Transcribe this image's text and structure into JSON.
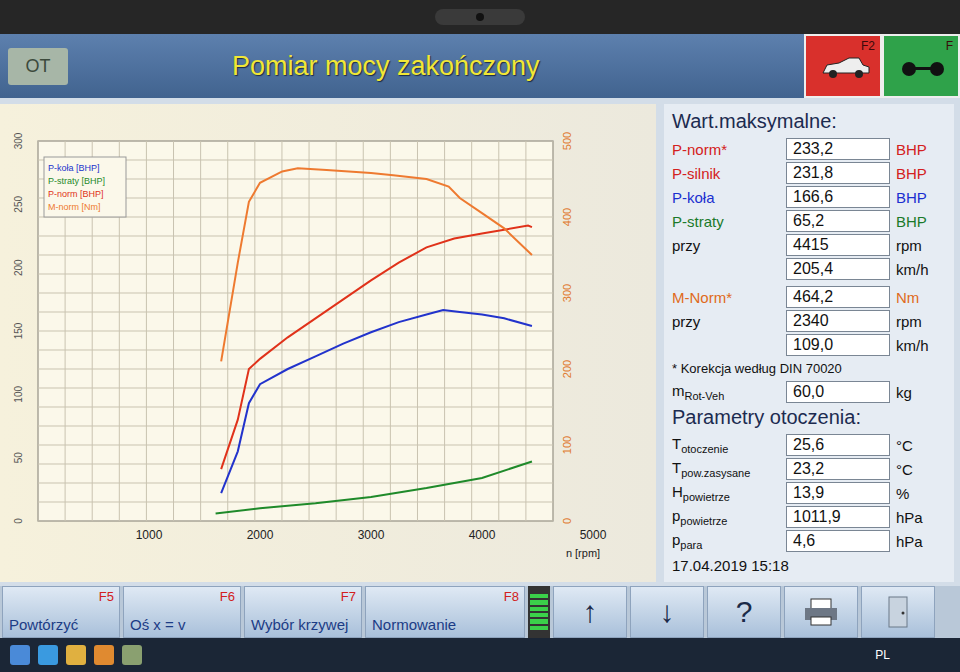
{
  "window": {
    "title": "Pomiar mocy zakończony"
  },
  "header": {
    "left_button": "OT",
    "function_keys": [
      {
        "label": "F2",
        "color": "#d9302c",
        "kind": "car"
      },
      {
        "label": "F",
        "color": "#2fa24a",
        "kind": "trailer"
      }
    ]
  },
  "chart": {
    "x_axis": {
      "ticks": [
        "1000",
        "2000",
        "3000",
        "4000",
        "5000"
      ],
      "label": "n [rpm]"
    },
    "left_axis": {
      "ticks": [
        "0",
        "50",
        "100",
        "150",
        "200",
        "250",
        "300"
      ]
    },
    "right_axis": {
      "ticks": [
        "0",
        "100",
        "200",
        "300",
        "400",
        "500"
      ]
    },
    "series": [
      {
        "name": "P-koła [BHP]",
        "color": "#2233cc",
        "axis": "left",
        "rpm": [
          1650,
          1800,
          1900,
          2000,
          2250,
          2500,
          2750,
          3000,
          3250,
          3500,
          3650,
          3800,
          4000,
          4200,
          4450
        ],
        "values": [
          22,
          55,
          93,
          108,
          120,
          130,
          140,
          149,
          157,
          163,
          166.6,
          165,
          163,
          160,
          154
        ]
      },
      {
        "name": "P-straty [BHP]",
        "color": "#1f8a2a",
        "axis": "left",
        "rpm": [
          1600,
          2000,
          2500,
          3000,
          3500,
          4000,
          4450
        ],
        "values": [
          6,
          10,
          14,
          19,
          26,
          34,
          47
        ]
      },
      {
        "name": "P-norm [BHP]",
        "color": "#e0321a",
        "axis": "left",
        "rpm": [
          1650,
          1800,
          1900,
          2000,
          2250,
          2500,
          2750,
          3000,
          3250,
          3500,
          3750,
          4000,
          4200,
          4415,
          4450
        ],
        "values": [
          41,
          80,
          120,
          128,
          145,
          160,
          175,
          190,
          204,
          216,
          223,
          227,
          230,
          233.2,
          232
        ]
      },
      {
        "name": "M-norm [Nm]",
        "color": "#ee7a30",
        "axis": "right",
        "rpm": [
          1650,
          1800,
          1900,
          2000,
          2200,
          2340,
          2600,
          2800,
          3000,
          3200,
          3500,
          3700,
          3800,
          4000,
          4200,
          4450
        ],
        "values": [
          210,
          340,
          420,
          445,
          460,
          464.2,
          462,
          460,
          458,
          455,
          450,
          440,
          425,
          405,
          385,
          350
        ]
      }
    ]
  },
  "max_values": {
    "title": "Wart.maksymalne:",
    "rows": [
      {
        "label": "P-norm*",
        "value": "233,2",
        "unit": "BHP",
        "color": "#d42020"
      },
      {
        "label": "P-silnik",
        "value": "231,8",
        "unit": "BHP",
        "color": "#d42020"
      },
      {
        "label": "P-koła",
        "value": "166,6",
        "unit": "BHP",
        "color": "#1a2fd0"
      },
      {
        "label": "P-straty",
        "value": "65,2",
        "unit": "BHP",
        "color": "#1a7a2a"
      },
      {
        "label": "przy",
        "value": "4415",
        "unit": "rpm",
        "color": "#111111"
      },
      {
        "label": "",
        "value": "205,4",
        "unit": "km/h",
        "color": "#111111"
      },
      {
        "label": "M-Norm*",
        "value": "464,2",
        "unit": "Nm",
        "color": "#e06a20"
      },
      {
        "label": "przy",
        "value": "2340",
        "unit": "rpm",
        "color": "#111111"
      },
      {
        "label": "",
        "value": "109,0",
        "unit": "km/h",
        "color": "#111111"
      }
    ]
  },
  "note": "* Korekcja według DIN 70020",
  "mass": {
    "label": "m",
    "sub": "Rot-Veh",
    "value": "60,0",
    "unit": "kg"
  },
  "ambient": {
    "title": "Parametry otoczenia:",
    "rows": [
      {
        "label": "T",
        "sub": "otoczenie",
        "value": "25,6",
        "unit": "°C"
      },
      {
        "label": "T",
        "sub": "pow.zasysane",
        "value": "23,2",
        "unit": "°C"
      },
      {
        "label": "H",
        "sub": "powietrze",
        "value": "13,9",
        "unit": "%"
      },
      {
        "label": "p",
        "sub": "powietrze",
        "value": "1011,9",
        "unit": "hPa"
      },
      {
        "label": "p",
        "sub": "para",
        "value": "4,6",
        "unit": "hPa"
      }
    ]
  },
  "timestamp": "17.04.2019 15:18",
  "buttons": [
    {
      "label": "Powtórzyć",
      "key": "F5"
    },
    {
      "label": "Oś x = v",
      "key": "F6"
    },
    {
      "label": "Wybór krzywej",
      "key": "F7"
    },
    {
      "label": "Normowanie",
      "key": "F8"
    }
  ],
  "indicator": {
    "level": 1
  },
  "nav_buttons": [
    {
      "kind": "text",
      "label": "↑"
    },
    {
      "kind": "text",
      "label": "↓"
    },
    {
      "kind": "text",
      "label": "?"
    },
    {
      "kind": "printer"
    },
    {
      "kind": "door"
    }
  ],
  "taskbar": {
    "language": "PL"
  }
}
